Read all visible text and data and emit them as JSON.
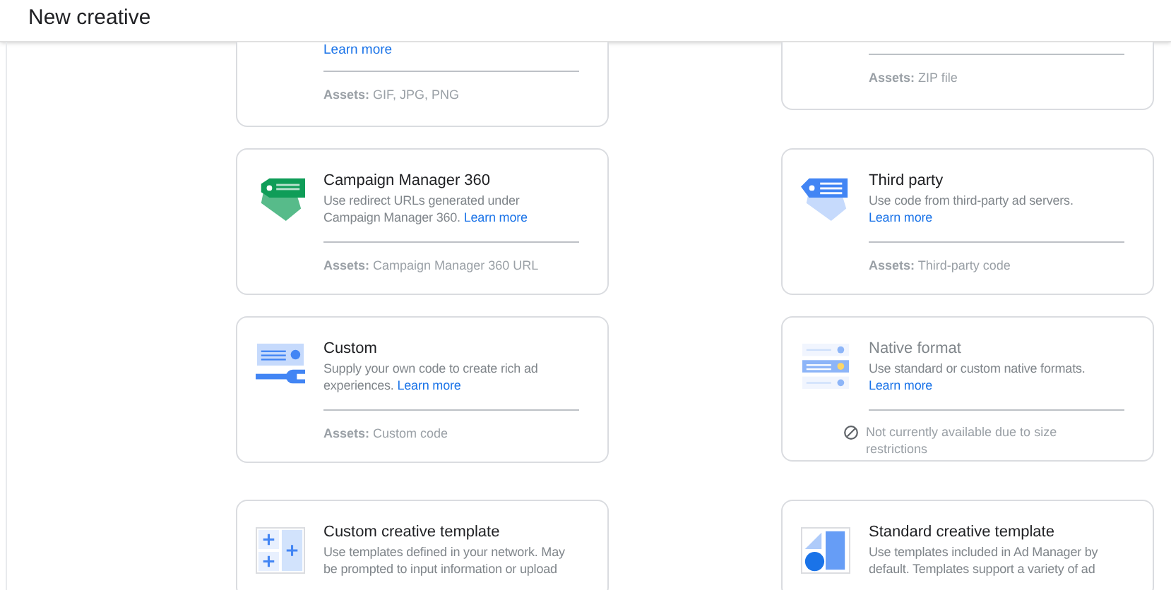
{
  "header": {
    "title": "New creative"
  },
  "cards": [
    {
      "link": "Learn more",
      "disabled": false,
      "footer": {
        "kind": "assets",
        "label": "Assets:",
        "value": "GIF, JPG, PNG"
      }
    },
    {
      "disabled": false,
      "footer": {
        "kind": "assets",
        "label": "Assets:",
        "value": "ZIP file"
      }
    },
    {
      "title": "Campaign Manager 360",
      "description": "Use redirect URLs generated under Campaign Manager 360.",
      "link": "Learn more",
      "disabled": false,
      "footer": {
        "kind": "assets",
        "label": "Assets:",
        "value": "Campaign Manager 360 URL"
      }
    },
    {
      "title": "Third party",
      "description": "Use code from third-party ad servers.",
      "link": "Learn more",
      "disabled": false,
      "footer": {
        "kind": "assets",
        "label": "Assets:",
        "value": "Third-party code"
      }
    },
    {
      "title": "Custom",
      "description": "Supply your own code to create rich ad experiences.",
      "link": "Learn more",
      "disabled": false,
      "footer": {
        "kind": "assets",
        "label": "Assets:",
        "value": "Custom code"
      }
    },
    {
      "title": "Native format",
      "description": "Use standard or custom native formats.",
      "link": "Learn more",
      "disabled": true,
      "footer": {
        "kind": "notice",
        "value": "Not currently available due to size restrictions"
      }
    },
    {
      "title": "Custom creative template",
      "description": "Use templates defined in your network. May be prompted to input information or upload",
      "disabled": false
    },
    {
      "title": "Standard creative template",
      "description": "Use templates included in Ad Manager by default. Templates support a variety of ad",
      "disabled": false
    }
  ]
}
